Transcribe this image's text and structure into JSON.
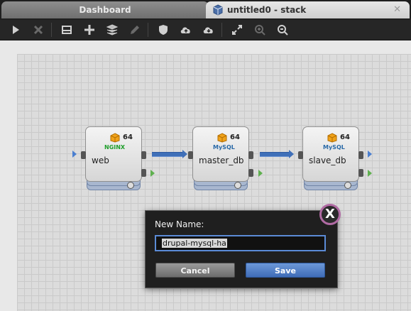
{
  "tabs": [
    {
      "label": "Dashboard"
    },
    {
      "label": "untitled0 - stack",
      "close": "✕",
      "icon": "stack-icon"
    }
  ],
  "toolbar": {
    "items": [
      "play-icon",
      "close-icon",
      "drive-icon",
      "plus-icon",
      "layers-icon",
      "pencil-icon",
      "shield-icon",
      "cloud-upload-icon",
      "cloud-download-icon",
      "expand-icon",
      "zoom-in-icon",
      "zoom-out-icon"
    ]
  },
  "nodes": [
    {
      "label": "web",
      "version": "64",
      "brand": "NGINX"
    },
    {
      "label": "master_db",
      "version": "64",
      "brand": "MySQL"
    },
    {
      "label": "slave_db",
      "version": "64",
      "brand": "MySQL"
    }
  ],
  "dialog": {
    "title": "New Name:",
    "value": "drupal-mysql-ha",
    "cancel_label": "Cancel",
    "save_label": "Save",
    "close_label": "X"
  },
  "colors": {
    "accent": "#4a7fd0",
    "save": "#4b79c6",
    "close_ring": "#b06aa3"
  }
}
